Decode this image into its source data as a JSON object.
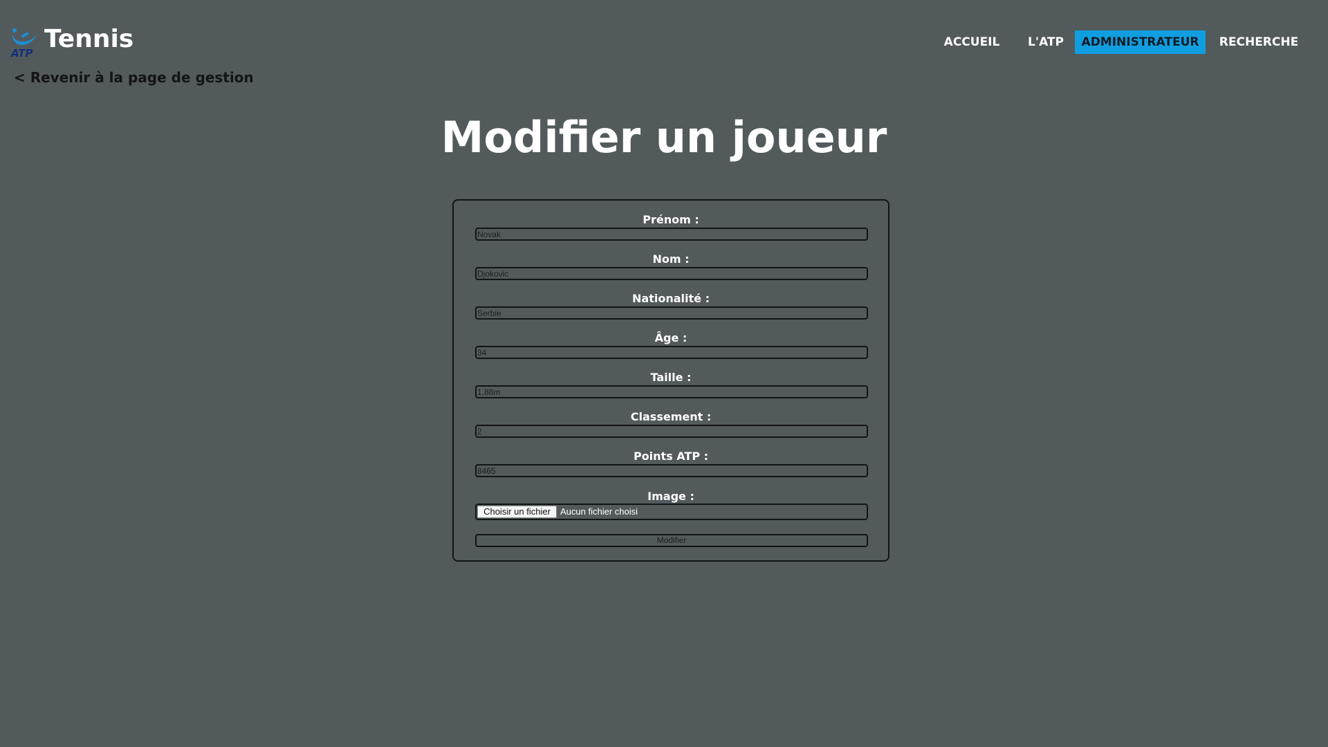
{
  "header": {
    "logo_text": "ATP",
    "brand": "Tennis",
    "nav": [
      {
        "label": "ACCUEIL",
        "active": false
      },
      {
        "label": "L'ATP",
        "active": false
      },
      {
        "label": "ADMINISTRATEUR",
        "active": true
      },
      {
        "label": "RECHERCHE",
        "active": false
      }
    ]
  },
  "back_link": "< Revenir à la page de gestion",
  "page_title": "Modifier un joueur",
  "form": {
    "fields": [
      {
        "label": "Prénom :",
        "value": "Novak"
      },
      {
        "label": "Nom :",
        "value": "Djokovic"
      },
      {
        "label": "Nationalité :",
        "value": "Serbie"
      },
      {
        "label": "Âge :",
        "value": "34"
      },
      {
        "label": "Taille :",
        "value": "1,88m"
      },
      {
        "label": "Classement :",
        "value": "2"
      },
      {
        "label": "Points ATP :",
        "value": "8465"
      }
    ],
    "image": {
      "label": "Image :",
      "button": "Choisir un fichier",
      "status": "Aucun fichier choisi"
    },
    "submit": "Modifier"
  },
  "colors": {
    "background": "#525a5c",
    "accent": "#109ee0",
    "logo_blue": "#1d8fd6",
    "logo_navy": "#12307a"
  }
}
